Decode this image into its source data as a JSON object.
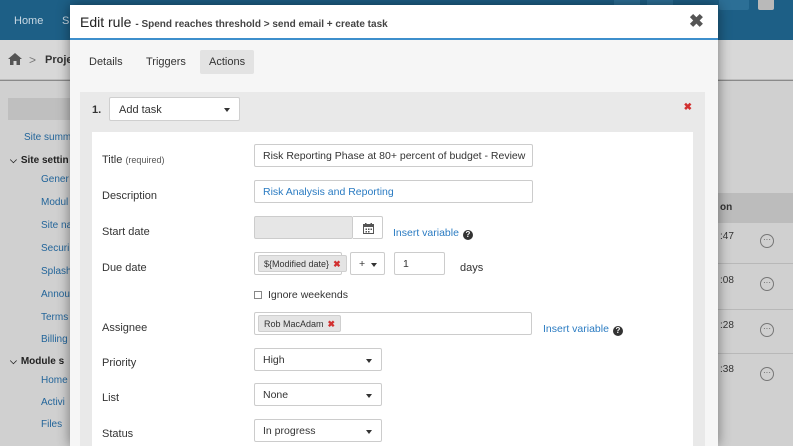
{
  "background": {
    "top_nav": [
      "Home",
      "S"
    ],
    "breadcrumb": "Proje",
    "sidebar": {
      "links": [
        "Site summ",
        "Gener",
        "Modul",
        "Site na",
        "Securi",
        "Splash",
        "Annou",
        "Terms",
        "Billing",
        "Home",
        "Activi",
        "Files"
      ],
      "sections": [
        "Site settin",
        "Module s"
      ]
    },
    "table": {
      "header": "on",
      "rows": [
        ":47",
        ":08",
        ":28",
        ":38"
      ]
    }
  },
  "modal": {
    "title": "Edit rule",
    "subtitle": "- Spend reaches threshold > send email + create task",
    "close": "✖",
    "tabs": [
      "Details",
      "Triggers",
      "Actions"
    ],
    "active_tab": "Actions"
  },
  "action": {
    "number": "1.",
    "type": "Add task",
    "remove": "✖"
  },
  "form": {
    "title_label": "Title",
    "title_required": "(required)",
    "title_value": "Risk Reporting Phase at 80+ percent of budget - Review",
    "description_label": "Description",
    "description_value": "Risk Analysis and Reporting",
    "start_date_label": "Start date",
    "insert_variable": "Insert variable",
    "due_date_label": "Due date",
    "due_date_token": "${Modified date}",
    "due_date_operator": "+",
    "due_date_amount": "1",
    "due_date_unit": "days",
    "ignore_weekends": "Ignore weekends",
    "assignee_label": "Assignee",
    "assignee_value": "Rob MacAdam",
    "priority_label": "Priority",
    "priority_value": "High",
    "list_label": "List",
    "list_value": "None",
    "status_label": "Status",
    "status_value": "In progress"
  }
}
